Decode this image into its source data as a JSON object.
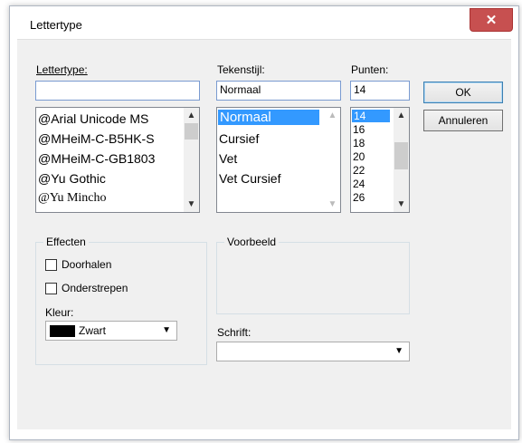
{
  "window": {
    "title": "Lettertype",
    "close_glyph": "✕"
  },
  "font": {
    "label": "Lettertype:",
    "value": "",
    "items": [
      "@Arial Unicode MS",
      "@MHeiM-C-B5HK-S",
      "@MHeiM-C-GB1803",
      "@Yu Gothic",
      "@Yu Mincho"
    ]
  },
  "style": {
    "label": "Tekenstijl:",
    "value": "Normaal",
    "items": [
      "Normaal",
      "Cursief",
      "Vet",
      "Vet Cursief"
    ],
    "selected": "Normaal"
  },
  "size": {
    "label": "Punten:",
    "value": "14",
    "items": [
      "14",
      "16",
      "18",
      "20",
      "22",
      "24",
      "26"
    ],
    "selected": "14"
  },
  "buttons": {
    "ok": "OK",
    "cancel": "Annuleren"
  },
  "effects": {
    "title": "Effecten",
    "strikeout": "Doorhalen",
    "underline": "Onderstrepen",
    "color_label": "Kleur:",
    "color_value": "Zwart",
    "color_hex": "#000000"
  },
  "preview": {
    "title": "Voorbeeld"
  },
  "script": {
    "label": "Schrift:",
    "value": ""
  }
}
